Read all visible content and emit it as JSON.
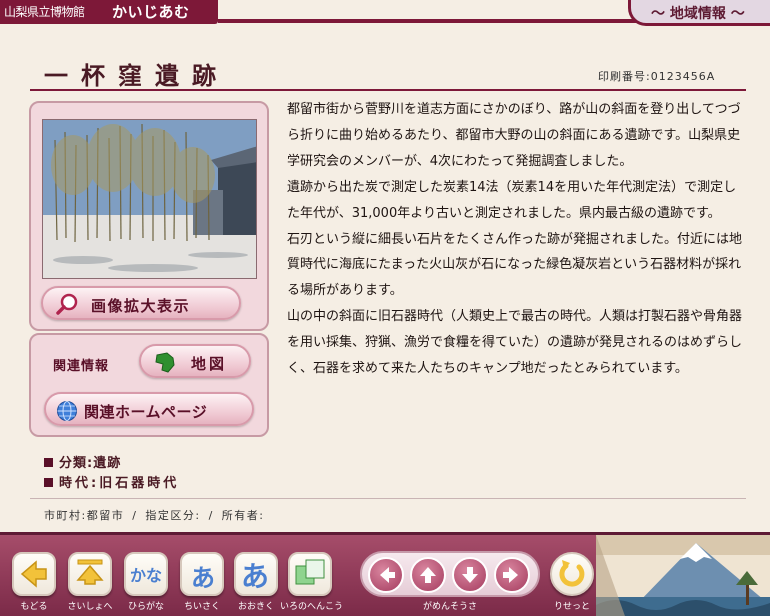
{
  "header": {
    "museum_name": "山梨県立博物館",
    "brand": "かいじあむ",
    "section": "～ 地域情報 ～"
  },
  "page": {
    "title": "一杯窪遺跡",
    "print_number": "印刷番号:0123456A"
  },
  "buttons": {
    "zoom_image": "画像拡大表示",
    "related_label": "関連情報",
    "map": "地図",
    "related_homepage": "関連ホームページ"
  },
  "meta": {
    "classification": "分類:遺跡",
    "era": "時代:旧石器時代"
  },
  "description": [
    "都留市街から菅野川を道志方面にさかのぼり、路が山の斜面を登り出してつづら折りに曲り始めるあたり、都留市大野の山の斜面にある遺跡です。山梨県史学研究会のメンバーが、4次にわたって発掘調査しました。",
    "遺跡から出た炭で測定した炭素14法（炭素14を用いた年代測定法）で測定した年代が、31,000年より古いと測定されました。県内最古級の遺跡です。",
    "石刃という縦に細長い石片をたくさん作った跡が発掘されました。付近には地質時代に海底にたまった火山灰が石になった緑色凝灰岩という石器材料が採れる場所があります。",
    "山の中の斜面に旧石器時代（人類史上で最古の時代。人類は打製石器や骨角器を用い採集、狩猟、漁労で食糧を得ていた）の遺跡が発見されるのはめずらしく、石器を求めて来た人たちのキャンプ地だったとみられています。"
  ],
  "footer_info": "市町村:都留市 / 指定区分: / 所有者:",
  "toolbar": {
    "back": "もどる",
    "first": "さいしょへ",
    "hiragana_glyph": "かな",
    "hiragana": "ひらがな",
    "smaller_glyph": "あ",
    "smaller": "ちいさく",
    "larger_glyph": "あ",
    "larger": "おおきく",
    "color": "いろのへんこう",
    "scroll": "がめんそうさ",
    "reset": "りせっと"
  },
  "colors": {
    "accent": "#7d1838",
    "button_bg": "#f1cdd6",
    "toolbar": "#8e3656"
  }
}
